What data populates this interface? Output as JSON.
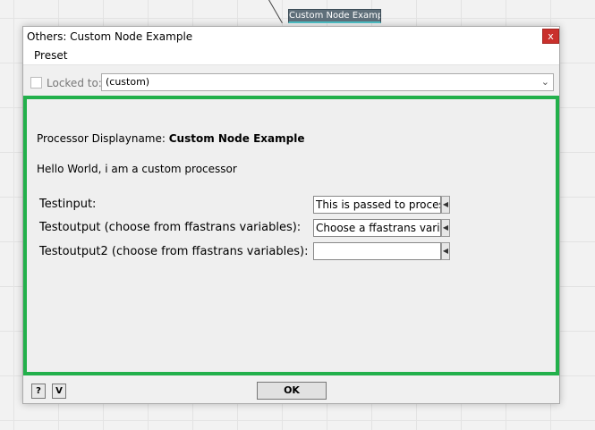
{
  "background": {
    "node_label": "Custom Node Example"
  },
  "window": {
    "title": "Others: Custom Node Example",
    "close_label": "x",
    "close_color": "#c9302c"
  },
  "menu": {
    "preset_label": "Preset"
  },
  "lockbar": {
    "locked_label": "Locked to:",
    "locked_checked": false,
    "preset_value": "(custom)",
    "dropdown_icon": "chevron-down-icon"
  },
  "panel": {
    "border_color": "#22b04b",
    "display_label": "Processor Displayname: ",
    "display_value": "Custom Node Example",
    "hello_text": "Hello World, i am a custom processor",
    "rows": [
      {
        "label": "Testinput:",
        "value": "This is passed to process"
      },
      {
        "label": "Testoutput (choose from ffastrans variables):",
        "value": "Choose a ffastrans variable"
      },
      {
        "label": "Testoutput2 (choose from ffastrans variables):",
        "value": ""
      }
    ],
    "field_button_icon": "triangle-left-icon"
  },
  "footer": {
    "help_label": "?",
    "v_label": "V",
    "ok_label": "OK"
  }
}
